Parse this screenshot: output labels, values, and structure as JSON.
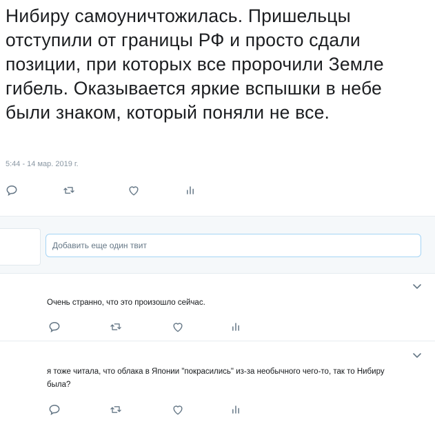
{
  "tweet": {
    "text": "Нибиру самоуничтожилась. Пришельцы отступили от границы РФ и просто сдали позиции, при которых все пророчили Земле гибель. Оказывается яркие вспышки в небе были знаком, который поняли не все.",
    "timestamp": "5:44 - 14 мар. 2019 г."
  },
  "compose": {
    "placeholder": "Добавить еще один твит"
  },
  "replies": [
    {
      "text": "Очень странно, что это произошло сейчас."
    },
    {
      "text": "я тоже читала, что облака в Японии \"покрасились\" из-за необычного чего-то, так то Нибиру была?"
    }
  ],
  "icons": [
    "reply-icon",
    "retweet-icon",
    "like-icon",
    "analytics-icon",
    "chevron-down-icon"
  ],
  "colors": {
    "icon_gray": "#657786",
    "input_border": "#a4d4f5",
    "divider": "#e6ecf0",
    "band": "#f5f8fa"
  }
}
